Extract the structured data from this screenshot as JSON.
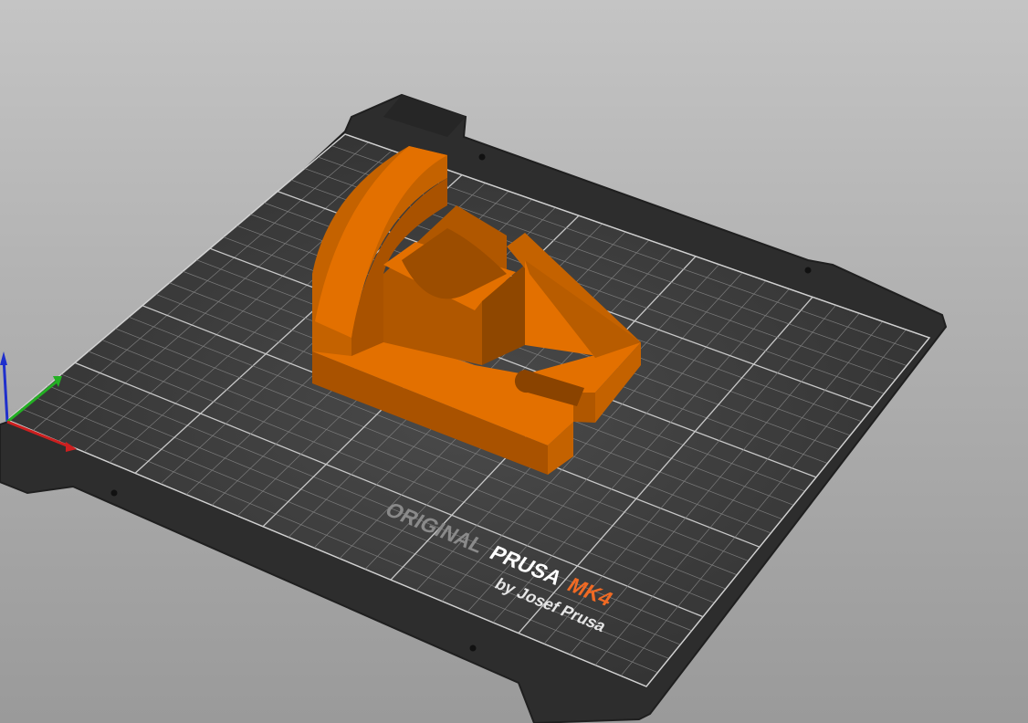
{
  "viewport": {
    "name": "3D view",
    "background_top": "#c4c4c4",
    "background_bottom": "#9a9a9a"
  },
  "bed": {
    "brand_original": "ORIGINAL",
    "brand_prusa": "PRUSA",
    "brand_model": "MK4",
    "brand_byline": "by Josef Prusa",
    "plate_color": "#2e2e2e",
    "grid_color": "#8c8c8c",
    "brand_accent_color": "#f06a24"
  },
  "model": {
    "color": "#e37000",
    "shade_color": "#b85800"
  },
  "axes": {
    "x_label": "X axis",
    "y_label": "Y axis",
    "z_label": "Z axis",
    "x_color": "#cc1f1f",
    "y_color": "#23b023",
    "z_color": "#1f2fcc"
  }
}
